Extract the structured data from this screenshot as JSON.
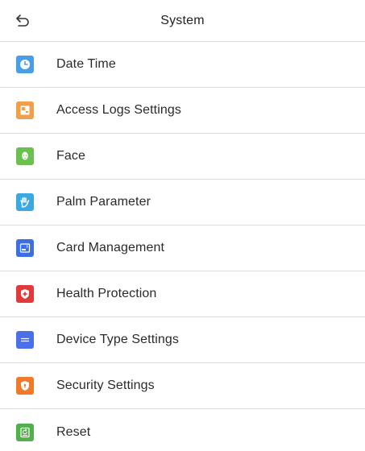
{
  "header": {
    "title": "System",
    "back_icon": "back-arrow-icon"
  },
  "menu": {
    "items": [
      {
        "label": "Date Time",
        "icon": "clock-icon",
        "color": "#4a9ee8"
      },
      {
        "label": "Access Logs Settings",
        "icon": "logs-icon",
        "color": "#f0a04a"
      },
      {
        "label": "Face",
        "icon": "face-icon",
        "color": "#6bc04f"
      },
      {
        "label": "Palm Parameter",
        "icon": "palm-icon",
        "color": "#3ba8e0"
      },
      {
        "label": "Card Management",
        "icon": "card-icon",
        "color": "#3d6fe0"
      },
      {
        "label": "Health Protection",
        "icon": "shield-cross-icon",
        "color": "#e23a3a"
      },
      {
        "label": "Device Type Settings",
        "icon": "device-type-icon",
        "color": "#4a6fe6"
      },
      {
        "label": "Security Settings",
        "icon": "security-shield-icon",
        "color": "#f07a2a"
      },
      {
        "label": "Reset",
        "icon": "reset-icon",
        "color": "#52b04a"
      }
    ]
  }
}
